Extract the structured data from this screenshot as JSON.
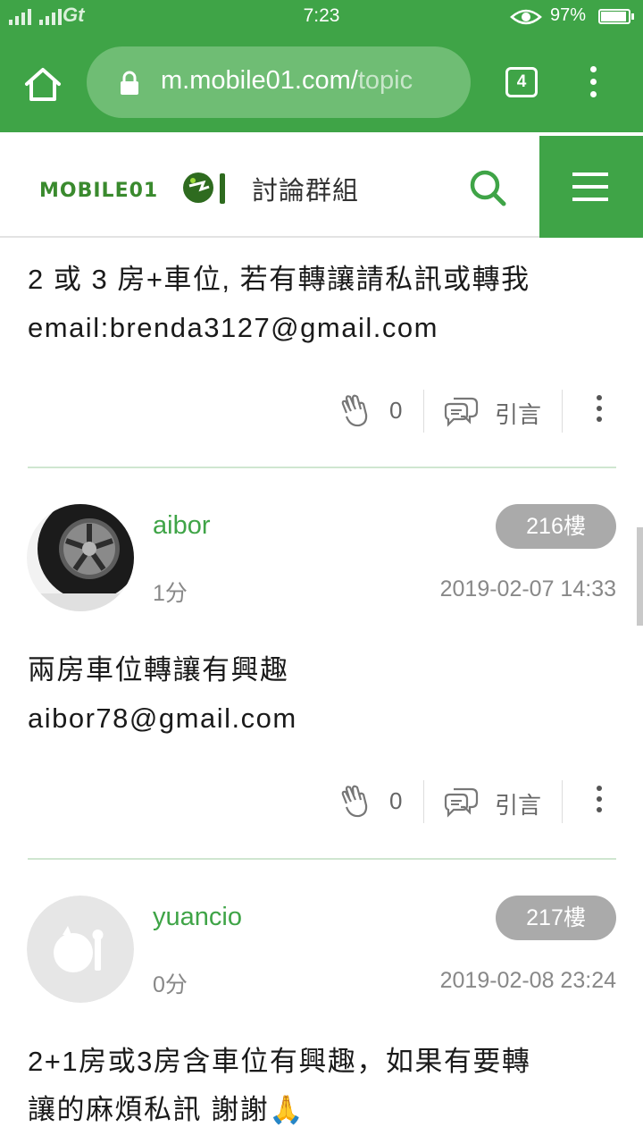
{
  "status_bar": {
    "network": "Gt",
    "time": "7:23",
    "battery": "97%"
  },
  "browser": {
    "url_main": "m.mobile01.com/",
    "url_rest": "topic",
    "tab_count": "4"
  },
  "site": {
    "section_title": "討論群組"
  },
  "posts": [
    {
      "body_lines": [
        "2 或 3 房+車位, 若有轉讓請私訊或轉我",
        "email:brenda3127@gmail.com"
      ],
      "clap_count": "0",
      "quote_label": "引言"
    },
    {
      "username": "aibor",
      "score": "1分",
      "floor": "216樓",
      "date": "2019-02-07 14:33",
      "body_lines": [
        "兩房車位轉讓有興趣",
        "aibor78@gmail.com"
      ],
      "clap_count": "0",
      "quote_label": "引言"
    },
    {
      "username": "yuancio",
      "score": "0分",
      "floor": "217樓",
      "date": "2019-02-08 23:24",
      "body_lines": [
        "2+1房或3房含車位有興趣，如果有要轉",
        "讓的麻煩私訊 謝謝🙏"
      ]
    }
  ],
  "colors": {
    "brand_green": "#3fa447",
    "badge_gray": "#aaaaaa"
  }
}
